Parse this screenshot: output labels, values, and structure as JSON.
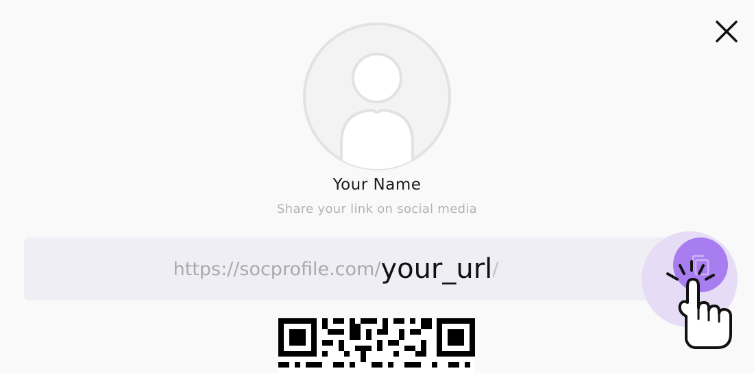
{
  "profile": {
    "name": "Your Name",
    "subtitle": "Share your link on social media"
  },
  "link": {
    "prefix": "https://socprofile.com/",
    "slug": "your_url",
    "suffix": "/"
  },
  "icons": {
    "close": "close-icon",
    "avatar": "user-avatar-icon",
    "copy": "copy-icon",
    "pointer": "hand-pointer-icon",
    "qr": "qr-code"
  },
  "colors": {
    "background": "#f9f9f9",
    "url_box": "#f0eef5",
    "accent": "#a87df0",
    "accent_halo": "#e6dcf6"
  }
}
